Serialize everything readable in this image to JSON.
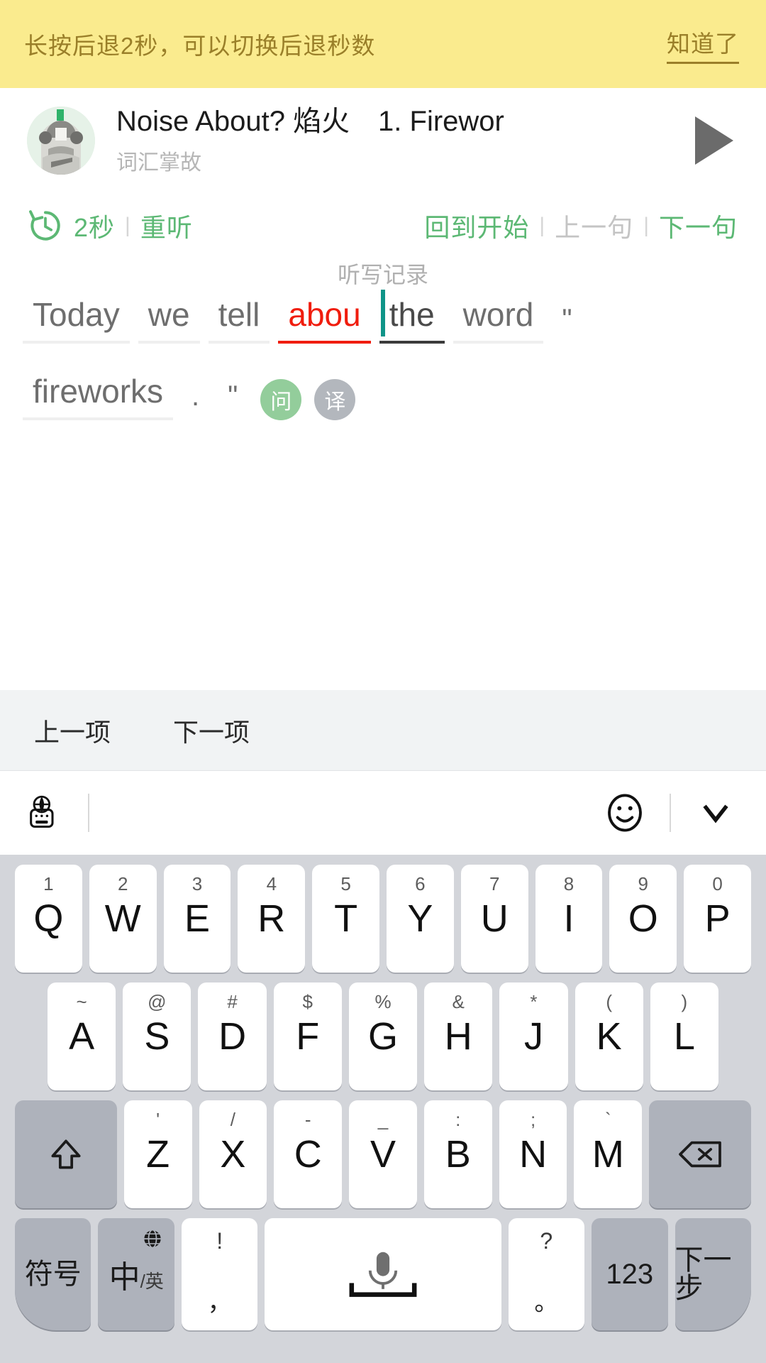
{
  "tip": {
    "message": "长按后退2秒，可以切换后退秒数",
    "action_label": "知道了"
  },
  "player": {
    "title": "Noise About? 焰火　1. Firewor",
    "subtitle": "词汇掌故",
    "play_icon": "play-triangle-icon",
    "avatar_icon": "podcast-avatar"
  },
  "controls": {
    "rewind_icon": "rewind-clock-icon",
    "rewind_label": "2秒",
    "replay_label": "重听",
    "back_to_start_label": "回到开始",
    "prev_sentence_label": "上一句",
    "next_sentence_label": "下一句",
    "separator": "|",
    "accent_color": "#5cb874",
    "disabled_color": "#c4c4c4"
  },
  "dictation": {
    "section_title": "听写记录",
    "line1": [
      {
        "text": "Today",
        "state": "normal"
      },
      {
        "text": "we",
        "state": "normal"
      },
      {
        "text": "tell",
        "state": "normal"
      },
      {
        "text": "abou",
        "state": "error"
      },
      {
        "text": "the",
        "state": "active"
      },
      {
        "text": "word",
        "state": "normal"
      },
      {
        "text": "\"",
        "state": "plain"
      }
    ],
    "line2": [
      {
        "text": "fireworks",
        "state": "normal"
      },
      {
        "text": ".",
        "state": "plain"
      },
      {
        "text": "\"",
        "state": "plain"
      }
    ],
    "badges": [
      {
        "label": "问",
        "kind": "ask",
        "color": "#93cd9b"
      },
      {
        "label": "译",
        "kind": "translate",
        "color": "#b3b7bd"
      }
    ],
    "error_color": "#f01d0e",
    "caret_color": "#0f9488"
  },
  "nav_strip": {
    "prev_label": "上一项",
    "next_label": "下一项"
  },
  "ime_bar": {
    "language_icon": "globe-keyboard-icon",
    "emoji_icon": "smiley-face-icon",
    "collapse_icon": "chevron-down-icon"
  },
  "keyboard": {
    "row1": [
      {
        "main": "Q",
        "alt": "1"
      },
      {
        "main": "W",
        "alt": "2"
      },
      {
        "main": "E",
        "alt": "3"
      },
      {
        "main": "R",
        "alt": "4"
      },
      {
        "main": "T",
        "alt": "5"
      },
      {
        "main": "Y",
        "alt": "6"
      },
      {
        "main": "U",
        "alt": "7"
      },
      {
        "main": "I",
        "alt": "8"
      },
      {
        "main": "O",
        "alt": "9"
      },
      {
        "main": "P",
        "alt": "0"
      }
    ],
    "row2": [
      {
        "main": "A",
        "alt": "~"
      },
      {
        "main": "S",
        "alt": "@"
      },
      {
        "main": "D",
        "alt": "#"
      },
      {
        "main": "F",
        "alt": "$"
      },
      {
        "main": "G",
        "alt": "%"
      },
      {
        "main": "H",
        "alt": "&"
      },
      {
        "main": "J",
        "alt": "*"
      },
      {
        "main": "K",
        "alt": "("
      },
      {
        "main": "L",
        "alt": ")"
      }
    ],
    "row3": {
      "shift_icon": "shift-arrow-icon",
      "letters": [
        {
          "main": "Z",
          "alt": "'"
        },
        {
          "main": "X",
          "alt": "/"
        },
        {
          "main": "C",
          "alt": "-"
        },
        {
          "main": "V",
          "alt": "_"
        },
        {
          "main": "B",
          "alt": ":"
        },
        {
          "main": "N",
          "alt": ";"
        },
        {
          "main": "M",
          "alt": "`"
        }
      ],
      "backspace_icon": "backspace-icon"
    },
    "row4": {
      "symbols_label": "符号",
      "lang_main": "中",
      "lang_sub": "/英",
      "lang_globe_icon": "globe-icon",
      "comma_top": "!",
      "comma_bottom": "，",
      "space_icon": "microphone-icon",
      "period_top": "?",
      "period_bottom": "。",
      "numbers_label": "123",
      "next_label": "下一步"
    }
  }
}
